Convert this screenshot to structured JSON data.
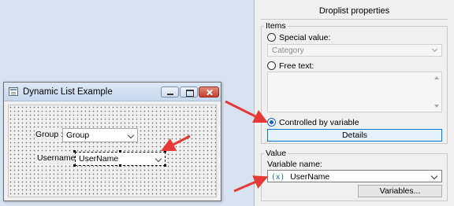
{
  "dialog": {
    "title": "Dynamic List Example",
    "group_label": "Group :",
    "group_value": "Group",
    "username_label": "Username:",
    "username_value": "UserName"
  },
  "properties": {
    "title": "Droplist properties",
    "items_label": "Items",
    "special_value_label": "Special value:",
    "special_value_placeholder": "Category",
    "free_text_label": "Free text:",
    "controlled_label": "Controlled by variable",
    "details_button": "Details",
    "value_label": "Value",
    "variable_name_label": "Variable name:",
    "variable_icon": "(x)",
    "variable_value": "UserName",
    "variables_button": "Variables..."
  },
  "colors": {
    "arrow": "#e53935",
    "accent": "#1565c0",
    "background": "#d7e3f1"
  }
}
